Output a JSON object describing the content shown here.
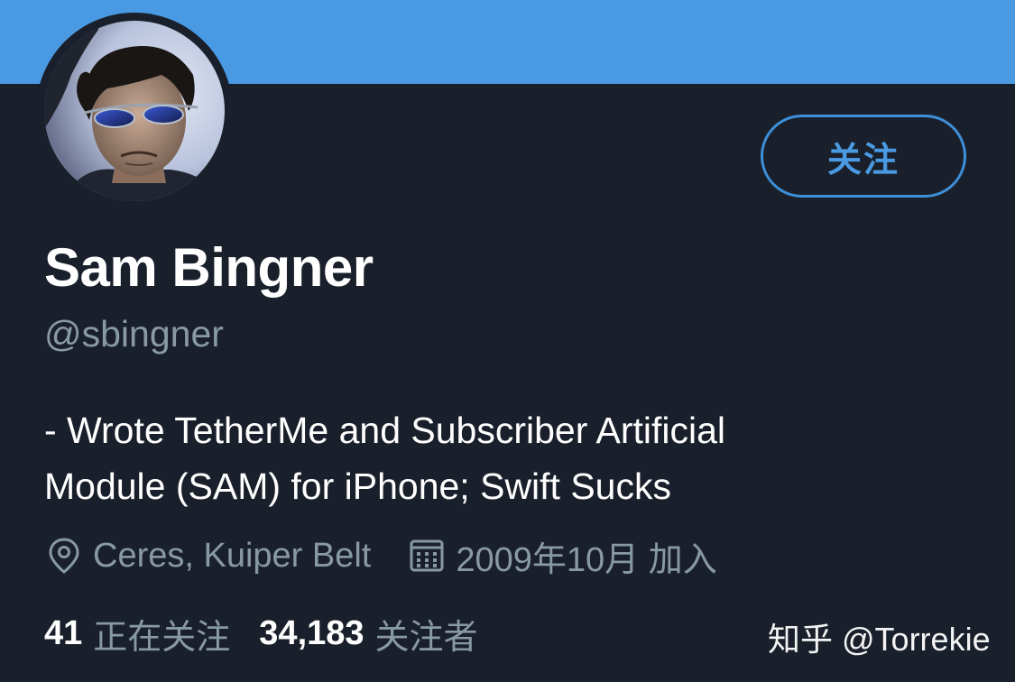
{
  "profile": {
    "name": "Sam Bingner",
    "handle": "@sbingner",
    "bio_line1": "- Wrote TetherMe and Subscriber Artificial",
    "bio_line2": "Module (SAM) for iPhone; Swift Sucks",
    "location": "Ceres, Kuiper Belt",
    "joined": "2009年10月 加入"
  },
  "actions": {
    "follow_label": "关注"
  },
  "stats": {
    "following_count": "41",
    "following_label": "正在关注",
    "followers_count": "34,183",
    "followers_label": "关注者"
  },
  "watermark": {
    "text": "知乎 @Torrekie"
  },
  "icons": {
    "location": "location-pin-icon",
    "calendar": "calendar-icon"
  },
  "colors": {
    "banner": "#4a9ae3",
    "background": "#1a202b",
    "accent": "#4a9ae3",
    "muted": "#8899a6",
    "text": "#ffffff"
  }
}
